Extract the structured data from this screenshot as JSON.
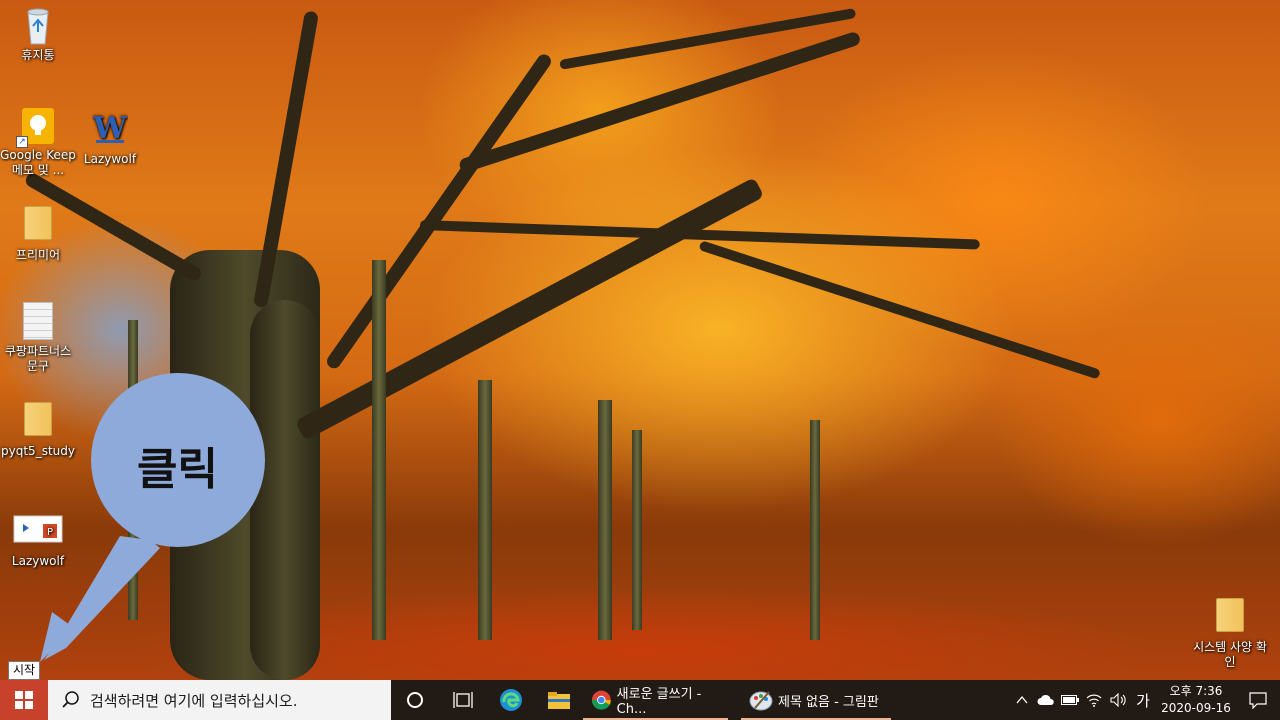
{
  "desktop": {
    "icons": [
      {
        "label": "휴지통"
      },
      {
        "label": "Google Keep 메모 및 ..."
      },
      {
        "label": "Lazywolf"
      },
      {
        "label": "프리미어"
      },
      {
        "label": "쿠팡파트너스 문구"
      },
      {
        "label": "pyqt5_study"
      },
      {
        "label": "Lazywolf"
      },
      {
        "label": "시스템 사양 확인"
      }
    ]
  },
  "callout": {
    "text": "클릭",
    "color": "#8eaadb"
  },
  "tooltip": {
    "text": "시작"
  },
  "taskbar": {
    "search_placeholder": "검색하려면 여기에 입력하십시오.",
    "apps": [
      {
        "label": "새로운 글쓰기 - Ch...",
        "icon": "chrome-icon"
      },
      {
        "label": "제목 없음 - 그림판",
        "icon": "paint-icon"
      }
    ],
    "tray": {
      "ime": "가",
      "time": "오후 7:36",
      "date": "2020-09-16"
    },
    "start_color": "#c8412a"
  }
}
